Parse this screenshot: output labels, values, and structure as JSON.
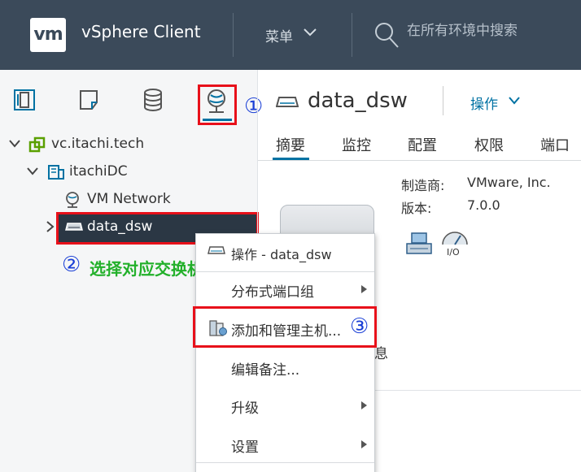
{
  "header": {
    "logo": "vm",
    "app_title": "vSphere Client",
    "menu_label": "菜单",
    "search_placeholder": "在所有环境中搜索"
  },
  "nav_icons": [
    "hosts-clusters-icon",
    "vms-templates-icon",
    "storage-icon",
    "networking-icon"
  ],
  "annotations": {
    "step1": "①",
    "step2": "②",
    "step2_text": "选择对应交换机",
    "step3": "③"
  },
  "tree": {
    "vcenter": "vc.itachi.tech",
    "datacenter": "itachiDC",
    "network": "VM Network",
    "switch": "data_dsw"
  },
  "object": {
    "title": "data_dsw",
    "actions_label": "操作"
  },
  "tabs": [
    "摘要",
    "监控",
    "配置",
    "权限",
    "端口"
  ],
  "summary": {
    "manufacturer_label": "制造商:",
    "manufacturer_value": "VMware, Inc.",
    "version_label": "版本:",
    "version_value": "7.0.0",
    "partial_text": "息"
  },
  "context_menu": {
    "header": "操作 - data_dsw",
    "items": [
      "分布式端口组",
      "添加和管理主机...",
      "编辑备注...",
      "升级",
      "设置"
    ]
  },
  "colors": {
    "header_bg": "#3b4a5a",
    "accent": "#0072a3",
    "annotation_red": "#e8101a",
    "annotation_green": "#22b02a",
    "annotation_blue": "#1a3fd6"
  }
}
